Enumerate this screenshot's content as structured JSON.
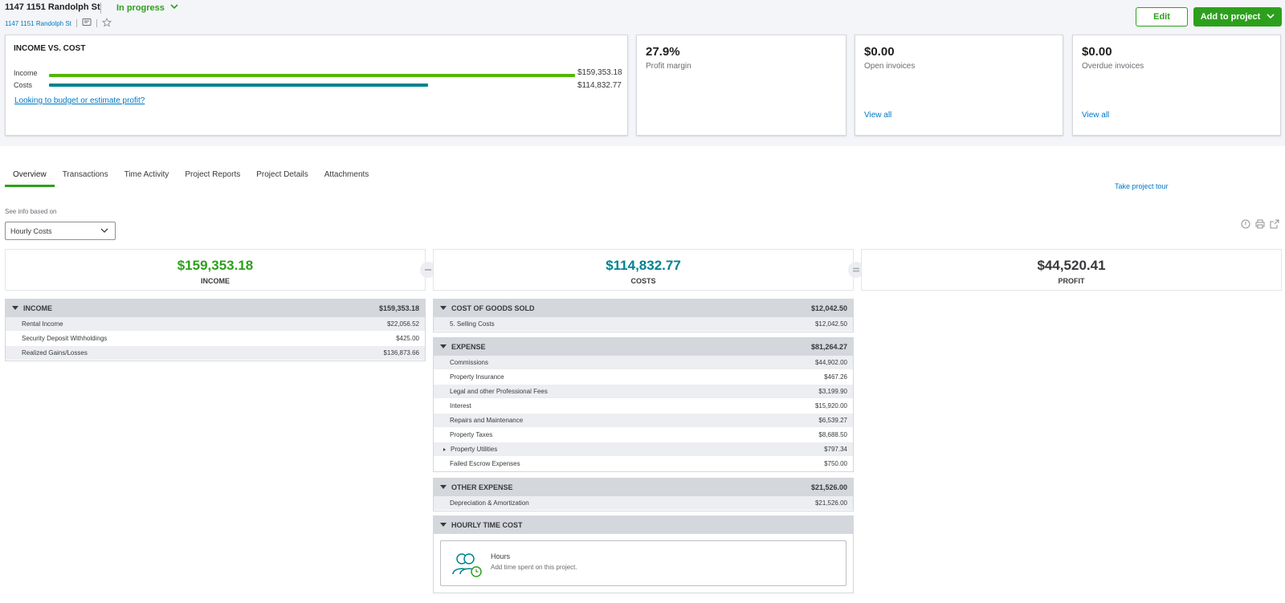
{
  "project": {
    "title": "1147 1151 Randolph St",
    "status": "In progress",
    "breadcrumb": "1147 1151 Randolph St"
  },
  "actions": {
    "edit_label": "Edit",
    "add_label": "Add to project"
  },
  "income_vs_cost": {
    "title": "INCOME VS. COST",
    "income_label": "Income",
    "income_value": "$159,353.18",
    "costs_label": "Costs",
    "costs_value": "$114,832.77",
    "link": "Looking to budget or estimate profit?",
    "income_color": "#53b700",
    "costs_color": "#00838f"
  },
  "stat_cards": [
    {
      "value": "27.9%",
      "label": "Profit margin",
      "link": ""
    },
    {
      "value": "$0.00",
      "label": "Open invoices",
      "link": "View all"
    },
    {
      "value": "$0.00",
      "label": "Overdue invoices",
      "link": "View all"
    }
  ],
  "tabs": [
    "Overview",
    "Transactions",
    "Time Activity",
    "Project Reports",
    "Project Details",
    "Attachments"
  ],
  "tour_link": "Take project tour",
  "filter": {
    "label": "See info based on",
    "selected": "Hourly Costs"
  },
  "summary": {
    "income": {
      "amount": "$159,353.18",
      "label": "INCOME",
      "color": "#2ca01c"
    },
    "costs": {
      "amount": "$114,832.77",
      "label": "COSTS",
      "color": "#00838f"
    },
    "profit": {
      "amount": "$44,520.41",
      "label": "PROFIT",
      "color": "#393a3d"
    }
  },
  "income_table": {
    "title": "INCOME",
    "total": "$159,353.18",
    "rows": [
      {
        "name": "Rental Income",
        "amount": "$22,056.52"
      },
      {
        "name": "Security Deposit Withholdings",
        "amount": "$425.00"
      },
      {
        "name": "Realized Gains/Losses",
        "amount": "$136,873.66"
      }
    ]
  },
  "cogs_table": {
    "title": "COST OF GOODS SOLD",
    "total": "$12,042.50",
    "rows": [
      {
        "name": "5. Selling Costs",
        "amount": "$12,042.50"
      }
    ]
  },
  "expense_table": {
    "title": "EXPENSE",
    "total": "$81,264.27",
    "rows": [
      {
        "name": "Commissions",
        "amount": "$44,902.00"
      },
      {
        "name": "Property Insurance",
        "amount": "$467.26"
      },
      {
        "name": "Legal and other Professional Fees",
        "amount": "$3,199.90"
      },
      {
        "name": "Interest",
        "amount": "$15,920.00"
      },
      {
        "name": "Repairs and Maintenance",
        "amount": "$6,539.27"
      },
      {
        "name": "Property Taxes",
        "amount": "$8,688.50"
      },
      {
        "name": "Property Utilities",
        "amount": "$797.34"
      },
      {
        "name": "Failed Escrow Expenses",
        "amount": "$750.00"
      }
    ]
  },
  "other_expense_table": {
    "title": "OTHER EXPENSE",
    "total": "$21,526.00",
    "rows": [
      {
        "name": "Depreciation & Amortization",
        "amount": "$21,526.00"
      }
    ]
  },
  "hourly_table": {
    "title": "HOURLY TIME COST",
    "hours_title": "Hours",
    "hours_sub": "Add time spent on this project."
  }
}
